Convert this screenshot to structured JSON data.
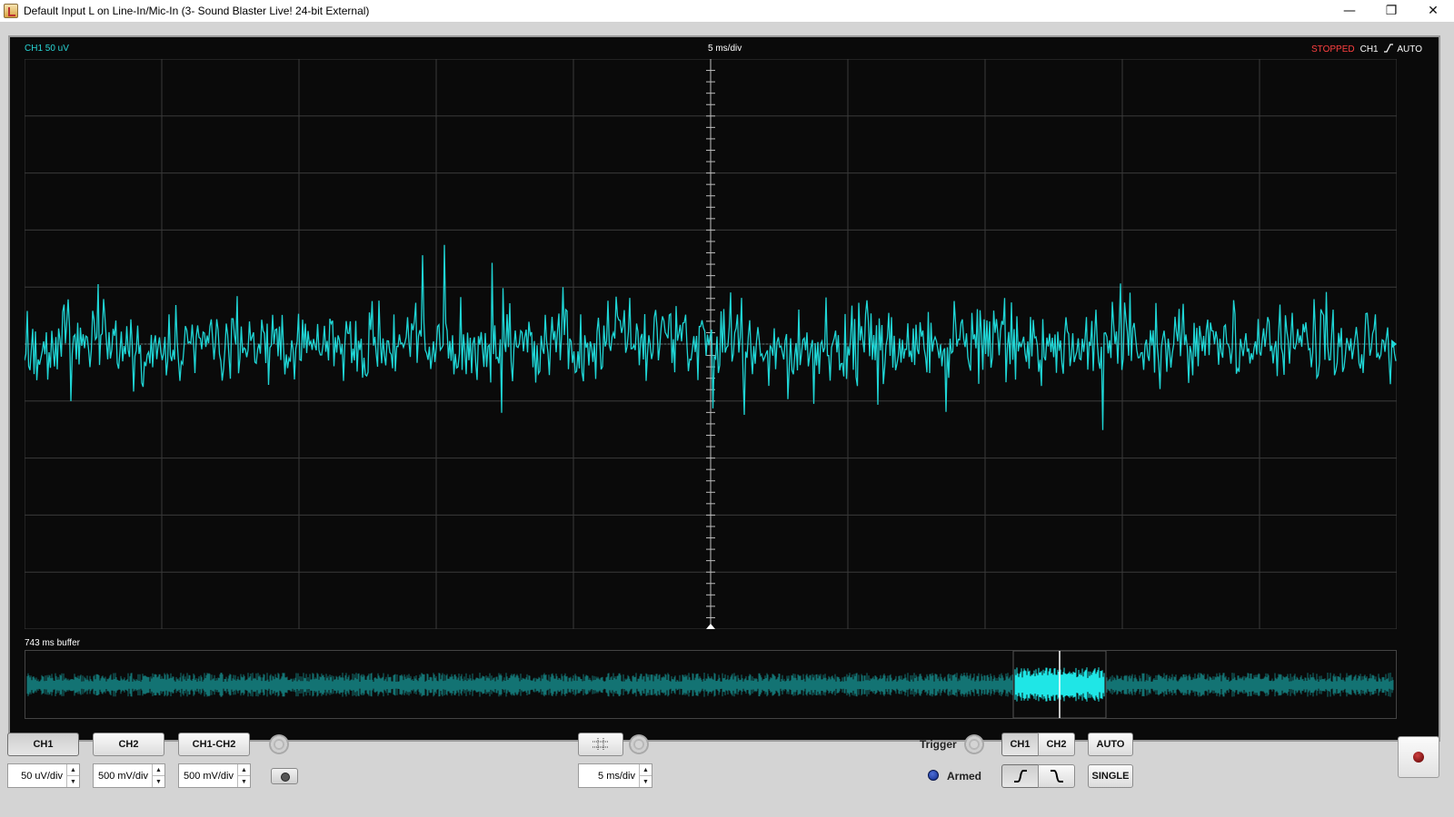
{
  "window": {
    "title": "Default Input L on Line-In/Mic-In (3- Sound Blaster Live! 24-bit External)",
    "controls": {
      "minimize": "—",
      "restore": "❐",
      "close": "✕"
    }
  },
  "scope": {
    "channel_label": "CH1 50 uV",
    "timebase_label": "5 ms/div",
    "status": "STOPPED",
    "trigger_summary_channel": "CH1",
    "trigger_summary_mode": "AUTO",
    "buffer_label": "743 ms buffer",
    "trace_color": "#1fd6d6",
    "grid_color": "#3a3a3a",
    "background": "#0a0a0a"
  },
  "controls": {
    "ch1": {
      "label": "CH1",
      "volts_per_div": "50 uV/div"
    },
    "ch2": {
      "label": "CH2",
      "volts_per_div": "500 mV/div"
    },
    "ch1_ch2": {
      "label": "CH1-CH2",
      "volts_per_div": "500 mV/div"
    },
    "timebase": {
      "value": "5 ms/div"
    },
    "trigger": {
      "label": "Trigger",
      "status": "Armed",
      "source_ch1": "CH1",
      "source_ch2": "CH2",
      "mode_auto": "AUTO",
      "mode_single": "SINGLE"
    }
  },
  "icons": {
    "settings": "gear-icon",
    "snapshot": "camera-icon",
    "grid": "grid-icon",
    "rising": "rising-edge-icon",
    "falling": "falling-edge-icon",
    "record": "record-icon"
  }
}
